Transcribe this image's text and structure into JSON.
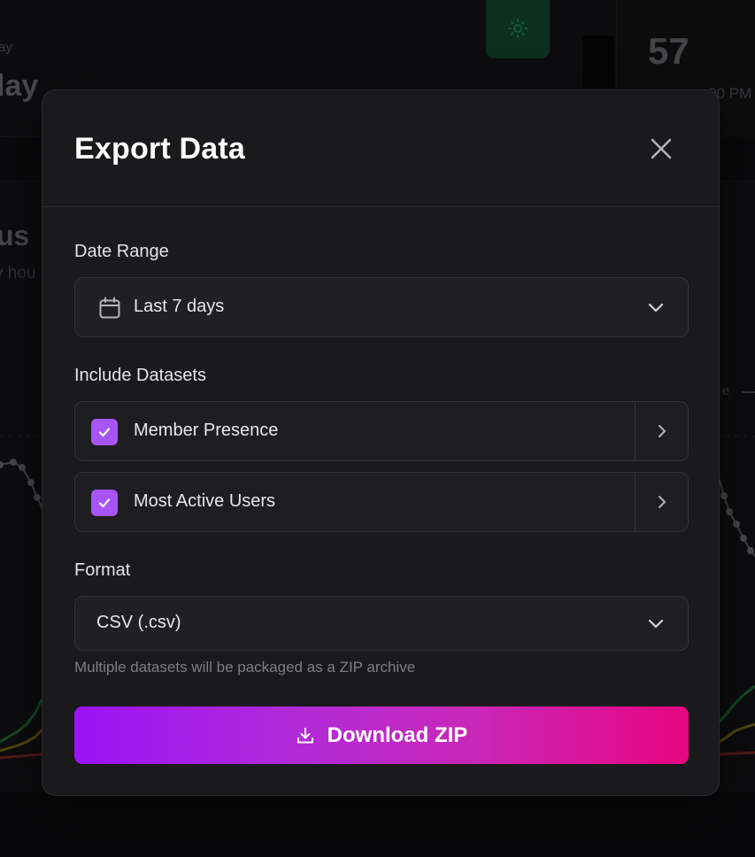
{
  "background": {
    "header_small_label": "ay",
    "header_title": "lay",
    "stat_value": "57",
    "stat_time": "00 PM",
    "chart_title": "us",
    "chart_subtitle": "y hou",
    "legend_fragment": "e"
  },
  "modal": {
    "title": "Export Data",
    "close_icon": "close-icon",
    "date_range": {
      "label": "Date Range",
      "value": "Last 7 days",
      "icon": "calendar-icon"
    },
    "datasets": {
      "label": "Include Datasets",
      "items": [
        {
          "label": "Member Presence",
          "checked": true
        },
        {
          "label": "Most Active Users",
          "checked": true
        }
      ]
    },
    "format": {
      "label": "Format",
      "value": "CSV (.csv)"
    },
    "hint": "Multiple datasets will be packaged as a ZIP archive",
    "download_button": {
      "label": "Download ZIP",
      "icon": "download-icon"
    }
  },
  "colors": {
    "accent_checkbox": "#a855f7",
    "button_gradient_start": "#9b12f5",
    "button_gradient_end": "#e6057f",
    "modal_bg": "#1a1a1d"
  }
}
